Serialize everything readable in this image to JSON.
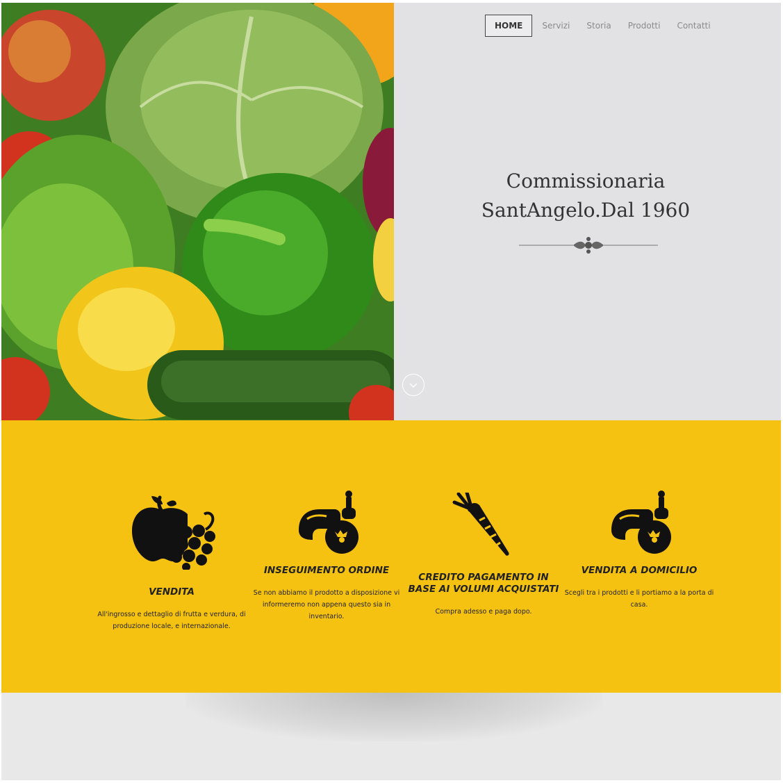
{
  "nav": {
    "items": [
      {
        "label": "HOME",
        "active": true
      },
      {
        "label": "Servizi"
      },
      {
        "label": "Storia"
      },
      {
        "label": "Prodotti"
      },
      {
        "label": "Contatti"
      }
    ]
  },
  "hero": {
    "title_line1": "Commissionaria",
    "title_line2": "SantAngelo.Dal 1960",
    "image_alt": "vegetables-photo",
    "scroll_icon": "chevron-down-icon"
  },
  "features": [
    {
      "icon": "fruit-icon",
      "title": "VENDITA",
      "text": "All'ingrosso e dettaglio di frutta e verdura, di produzione locale, e internazionale."
    },
    {
      "icon": "vegetables-icon",
      "title": "INSEGUIMENTO ORDINE",
      "text": "Se non abbiamo il prodotto a disposizione vi informeremo non appena questo sia in inventario."
    },
    {
      "icon": "carrot-icon",
      "title": "CREDITO PAGAMENTO IN BASE AI VOLUMI ACQUISTATI",
      "text": "Compra adesso e paga dopo."
    },
    {
      "icon": "vegetables-icon",
      "title": "VENDITA A DOMICILIO",
      "text": "Scegli tra i prodotti e li portiamo a la porta di casa."
    }
  ],
  "colors": {
    "accent": "#f5c211",
    "hero_bg": "#e2e2e4",
    "footer_bg": "#e8e8e8"
  }
}
